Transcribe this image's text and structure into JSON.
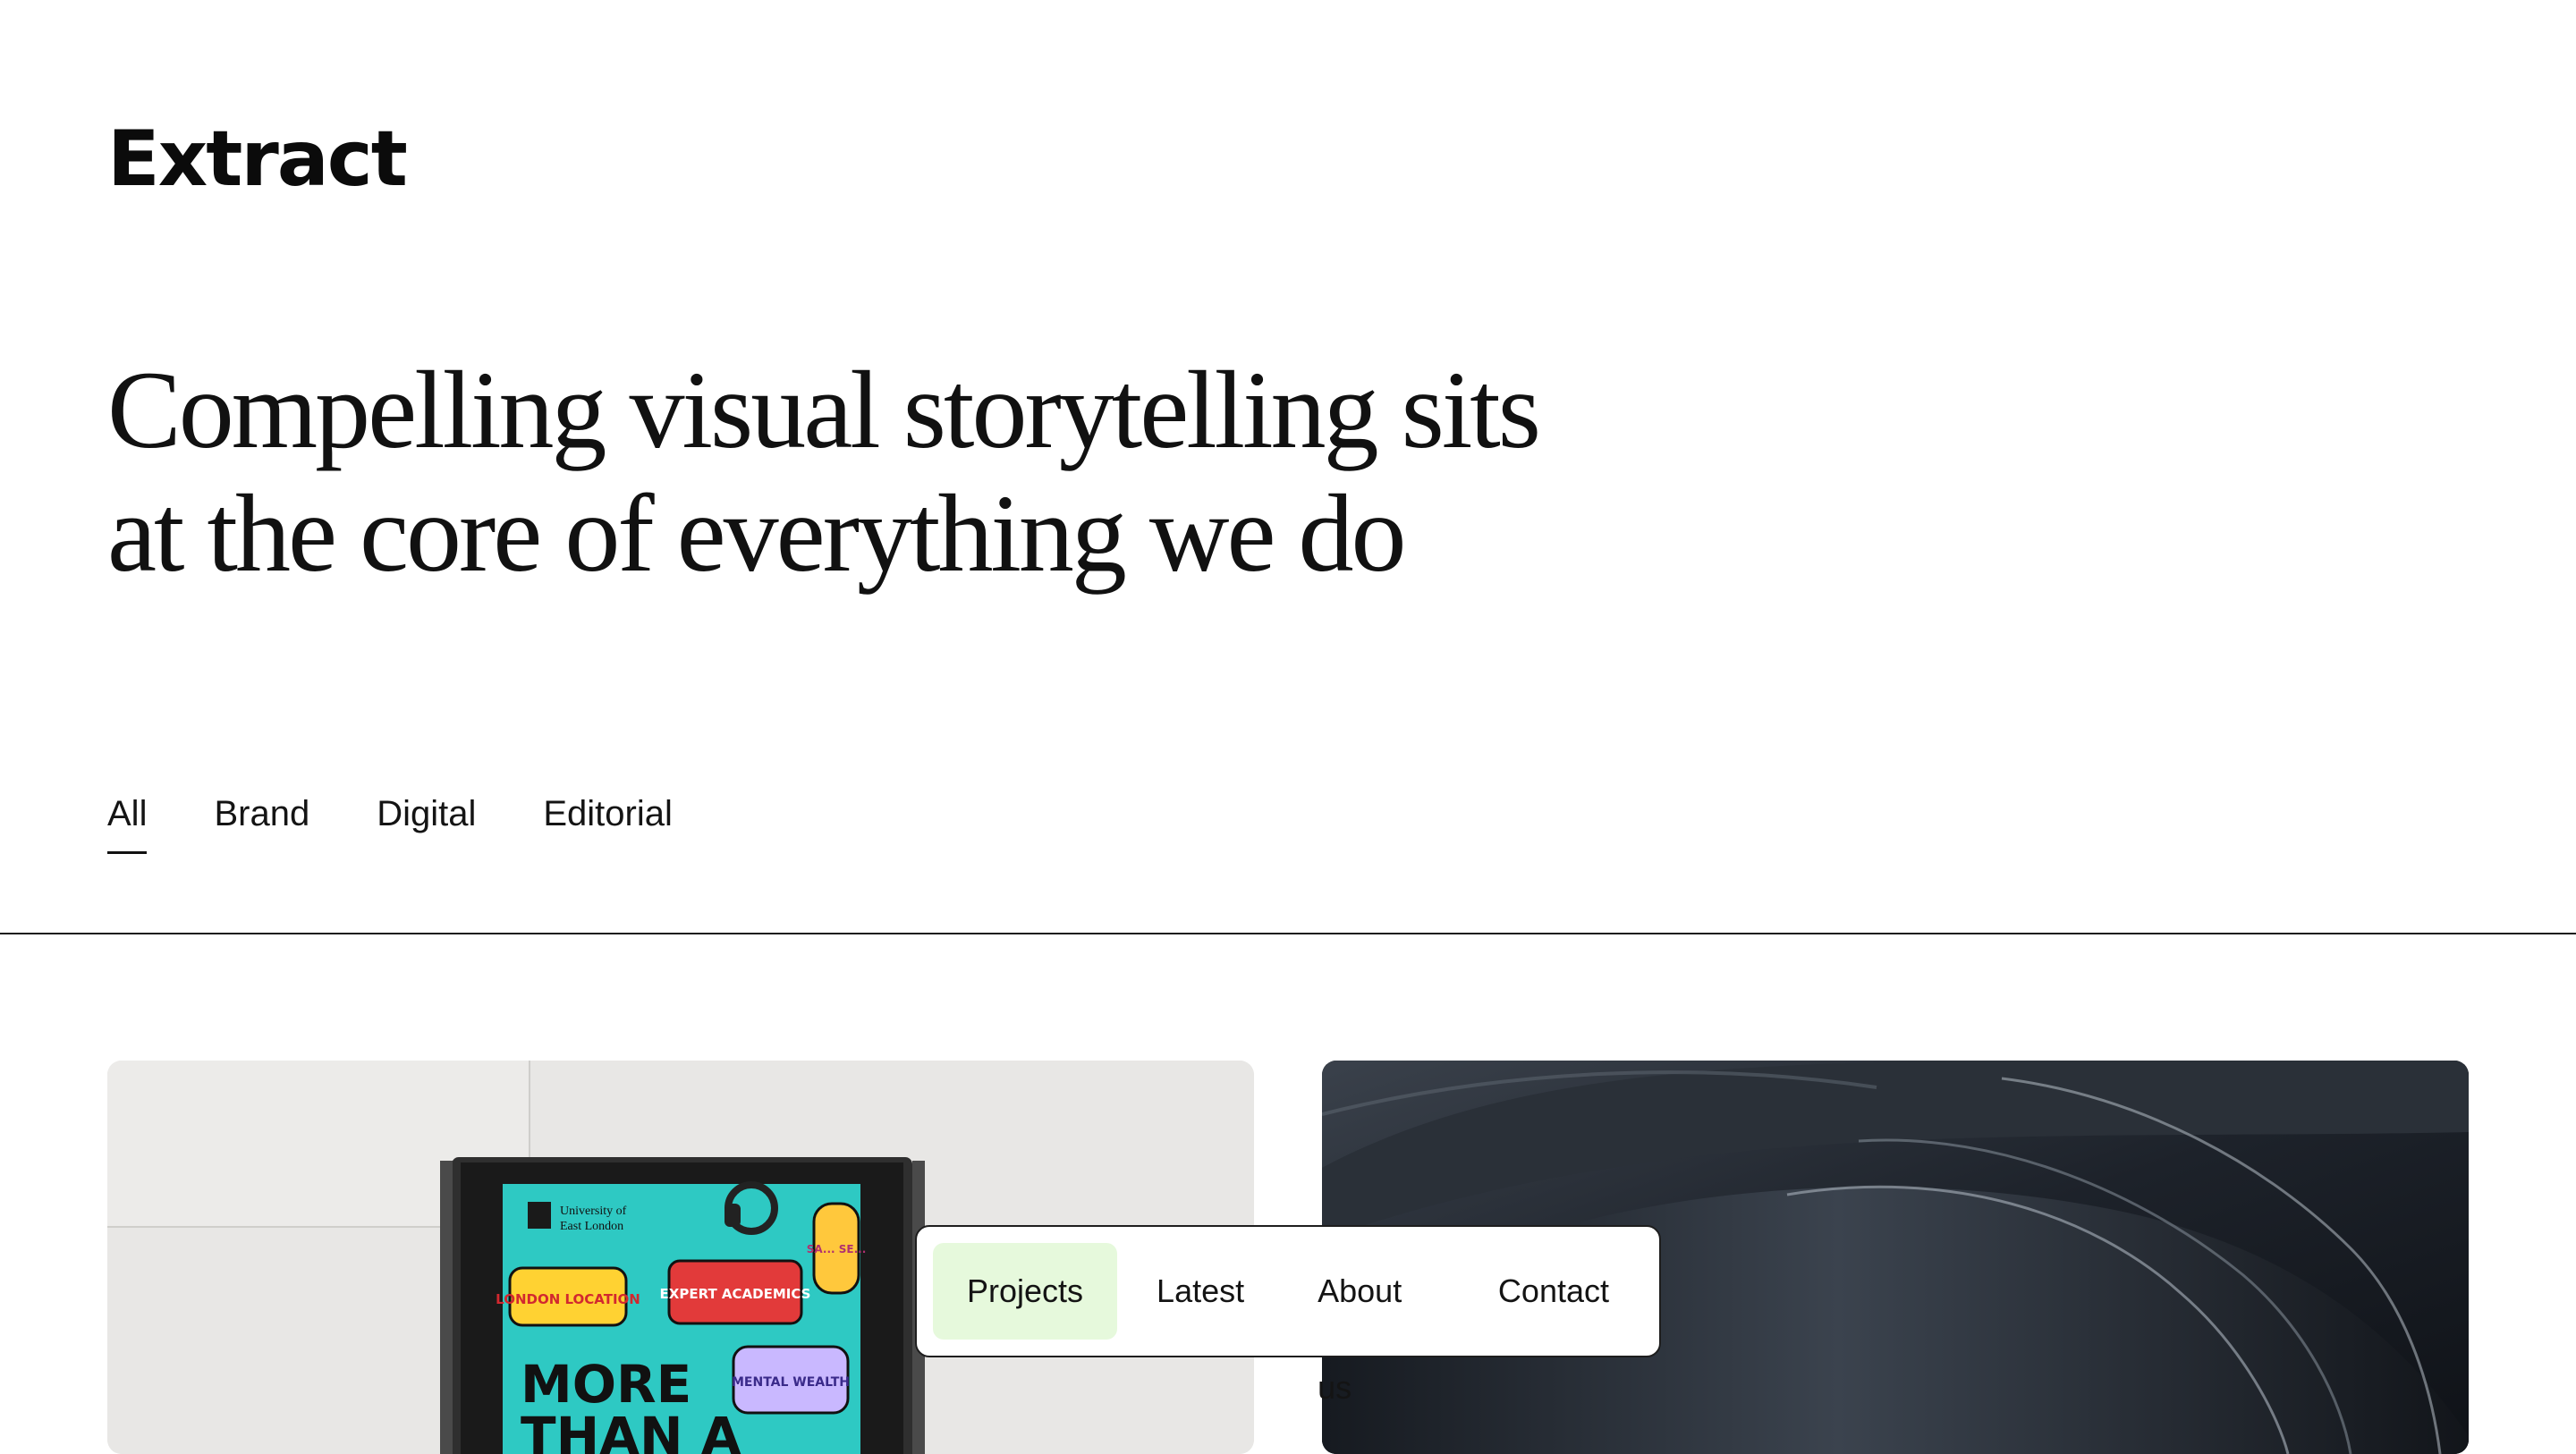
{
  "brand": {
    "logo_text": "Extract"
  },
  "hero": {
    "line1": "Compelling visual storytelling sits",
    "line2": "at the core of everything we do"
  },
  "filters": [
    {
      "label": "All",
      "active": true
    },
    {
      "label": "Brand",
      "active": false
    },
    {
      "label": "Digital",
      "active": false
    },
    {
      "label": "Editorial",
      "active": false
    }
  ],
  "projects": [
    {
      "image": "billboard-poster-photo",
      "poster": {
        "institution_line1": "University of",
        "institution_line2": "East London",
        "sticker1": "LONDON LOCATION",
        "sticker2": "EXPERT ACADEMICS",
        "sticker3": "MENTAL WEALTH",
        "sticker4": "SA... SE...",
        "headline": "MORE",
        "headline2": "THAN A"
      }
    },
    {
      "image": "abstract-dark-sculpture-photo"
    }
  ],
  "nav": [
    {
      "label": "Projects",
      "active": true
    },
    {
      "label": "Latest",
      "active": false
    },
    {
      "label": "About us",
      "active": false
    },
    {
      "label": "Contact",
      "active": false
    }
  ],
  "colors": {
    "nav_active_bg": "#e6f9dc",
    "poster_teal": "#2ec9c3",
    "text": "#111111"
  }
}
